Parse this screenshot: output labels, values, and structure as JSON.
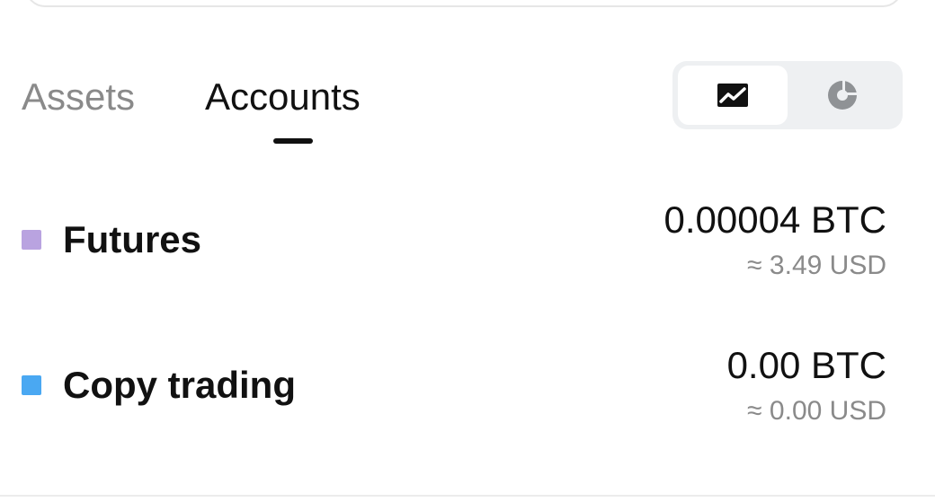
{
  "tabs": {
    "assets_label": "Assets",
    "accounts_label": "Accounts",
    "active": "Accounts"
  },
  "view_toggle": {
    "options": [
      {
        "icon": "line-chart-icon",
        "selected": true
      },
      {
        "icon": "pie-chart-icon",
        "selected": false
      }
    ]
  },
  "accounts": [
    {
      "name": "Futures",
      "color": "#b9a3e0",
      "amount": "0.00004 BTC",
      "usd": "≈ 3.49 USD"
    },
    {
      "name": "Copy trading",
      "color": "#4aa8f2",
      "amount": "0.00 BTC",
      "usd": "≈ 0.00 USD"
    }
  ],
  "colors": {
    "text_primary": "#111111",
    "text_secondary": "#8a8a8a",
    "toggle_bg": "#eef0f2"
  }
}
